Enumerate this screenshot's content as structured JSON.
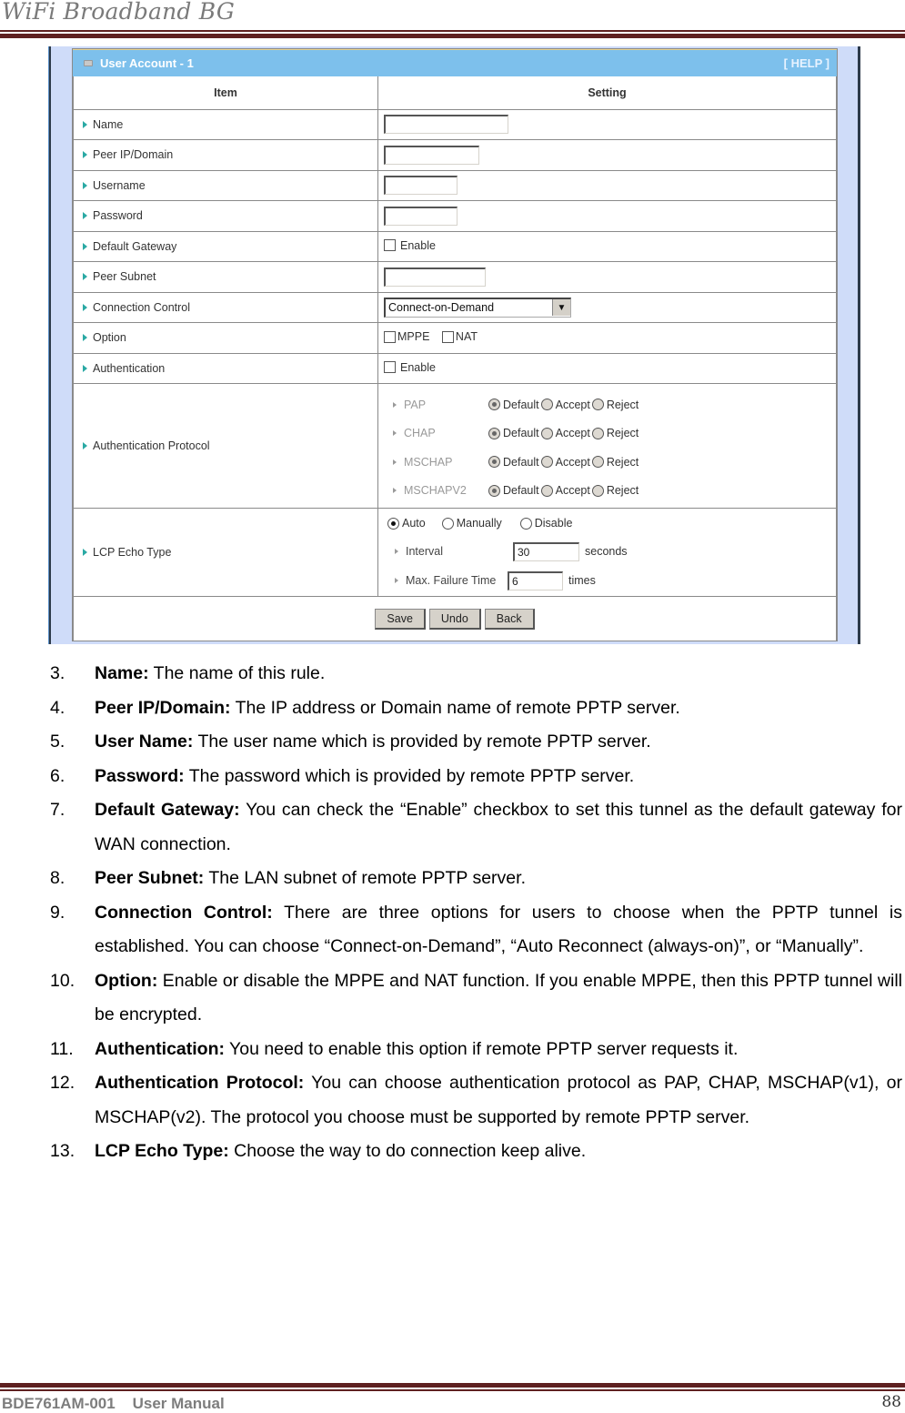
{
  "header": {
    "title": "WiFi Broadband BG"
  },
  "form": {
    "panel_title": "User Account - 1",
    "help_link": "[ HELP ]",
    "columns": {
      "item": "Item",
      "setting": "Setting"
    },
    "rows": {
      "name": {
        "label": "Name",
        "value": ""
      },
      "peer_ip": {
        "label": "Peer IP/Domain",
        "value": ""
      },
      "username": {
        "label": "Username",
        "value": ""
      },
      "password": {
        "label": "Password",
        "value": ""
      },
      "default_gateway": {
        "label": "Default Gateway",
        "checkbox_label": "Enable",
        "checked": false
      },
      "peer_subnet": {
        "label": "Peer Subnet",
        "value": ""
      },
      "connection_control": {
        "label": "Connection Control",
        "selected": "Connect-on-Demand"
      },
      "option": {
        "label": "Option",
        "mppe_label": "MPPE",
        "nat_label": "NAT",
        "mppe_checked": false,
        "nat_checked": false
      },
      "authentication": {
        "label": "Authentication",
        "checkbox_label": "Enable",
        "checked": false
      },
      "auth_protocol": {
        "label": "Authentication Protocol",
        "choices": [
          "Default",
          "Accept",
          "Reject"
        ],
        "protocols": [
          {
            "name": "PAP",
            "selected": "Default"
          },
          {
            "name": "CHAP",
            "selected": "Default"
          },
          {
            "name": "MSCHAP",
            "selected": "Default"
          },
          {
            "name": "MSCHAPV2",
            "selected": "Default"
          }
        ]
      },
      "lcp_echo": {
        "label": "LCP Echo Type",
        "modes": [
          "Auto",
          "Manually",
          "Disable"
        ],
        "selected_mode": "Auto",
        "interval_label": "Interval",
        "interval_value": "30",
        "interval_unit": "seconds",
        "max_failure_label": "Max. Failure Time",
        "max_failure_value": "6",
        "max_failure_unit": "times"
      }
    },
    "buttons": {
      "save": "Save",
      "undo": "Undo",
      "back": "Back"
    }
  },
  "descriptions": [
    {
      "num": "3.",
      "term": "Name:",
      "text": " The name of this rule."
    },
    {
      "num": "4.",
      "term": "Peer IP/Domain:",
      "text": " The IP address or Domain name of remote PPTP server."
    },
    {
      "num": "5.",
      "term": "User Name:",
      "text": " The user name which is provided by remote PPTP server."
    },
    {
      "num": "6.",
      "term": "Password:",
      "text": " The password which is provided by remote PPTP server."
    },
    {
      "num": "7.",
      "term": "Default Gateway:",
      "text": " You can check the “Enable” checkbox to set this tunnel as the default gateway for WAN connection."
    },
    {
      "num": "8.",
      "term": "Peer Subnet:",
      "text": " The LAN subnet of remote PPTP server."
    },
    {
      "num": "9.",
      "term": "Connection Control:",
      "text": " There are three options for users to choose when the PPTP tunnel is established. You can choose “Connect-on-Demand”, “Auto Reconnect (always-on)”, or “Manually”."
    },
    {
      "num": "10.",
      "term": "Option:",
      "text": " Enable or disable the MPPE and NAT function. If you enable MPPE, then this PPTP tunnel will be encrypted."
    },
    {
      "num": "11.",
      "term": "Authentication:",
      "text": " You need to enable this option if remote PPTP server requests it."
    },
    {
      "num": "12.",
      "term": "Authentication Protocol:",
      "text": " You can choose authentication protocol as PAP, CHAP, MSCHAP(v1), or MSCHAP(v2). The protocol you choose must be supported by remote PPTP server."
    },
    {
      "num": "13.",
      "term": "LCP Echo Type:",
      "text": " Choose the way to do connection keep alive."
    }
  ],
  "footer": {
    "doc_id": "BDE761AM-001    User Manual",
    "page_number": "88"
  }
}
